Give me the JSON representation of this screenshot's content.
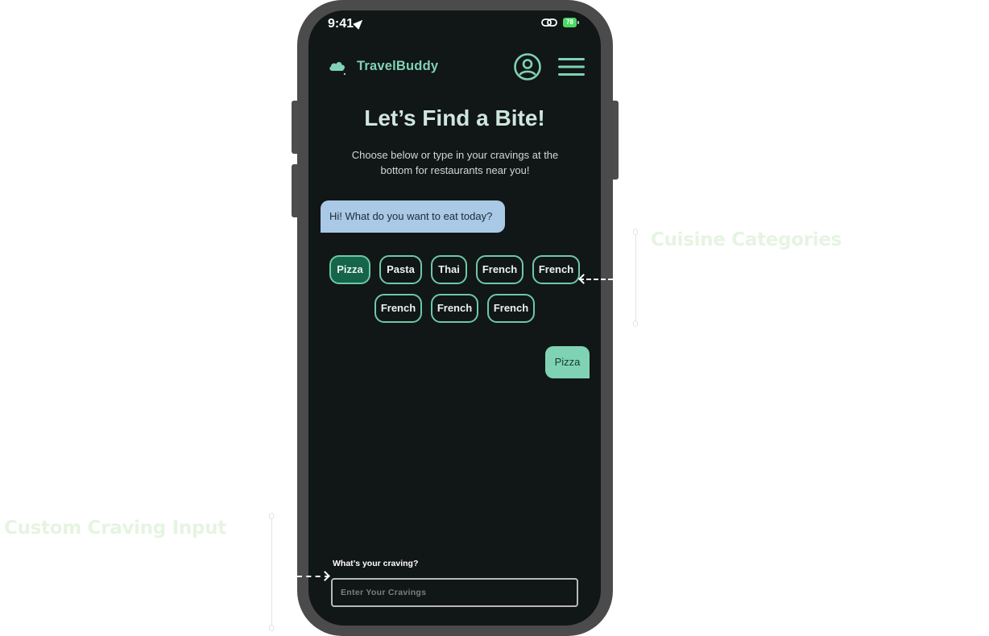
{
  "annotations": {
    "cuisine_label": "Cuisine Categories",
    "craving_label": "Custom Craving Input"
  },
  "status_bar": {
    "time": "9:41",
    "battery": "78"
  },
  "header": {
    "brand": "TravelBuddy",
    "icons": [
      "cloud-logo-icon",
      "profile-icon",
      "hamburger-menu-icon"
    ]
  },
  "main": {
    "title": "Let’s Find a Bite!",
    "subtitle": "Choose below or type in your cravings at the bottom for restaurants near you!",
    "bot_message": "Hi! What do you want to eat today?",
    "cuisine_chips": [
      {
        "label": "Pizza",
        "selected": true
      },
      {
        "label": "Pasta",
        "selected": false
      },
      {
        "label": "Thai",
        "selected": false
      },
      {
        "label": "French",
        "selected": false
      },
      {
        "label": "French",
        "selected": false
      },
      {
        "label": "French",
        "selected": false
      },
      {
        "label": "French",
        "selected": false
      },
      {
        "label": "French",
        "selected": false
      }
    ],
    "user_message": "Pizza"
  },
  "input": {
    "label": "What’s your craving?",
    "placeholder": "Enter Your Cravings",
    "value": ""
  },
  "colors": {
    "accent": "#7fd3b4",
    "chip_border": "#6ec9a6",
    "chip_selected": "#16644a",
    "bot_bubble": "#a9c9e6",
    "screen_bg": "#111616",
    "annotation": "#e6f4e2"
  }
}
